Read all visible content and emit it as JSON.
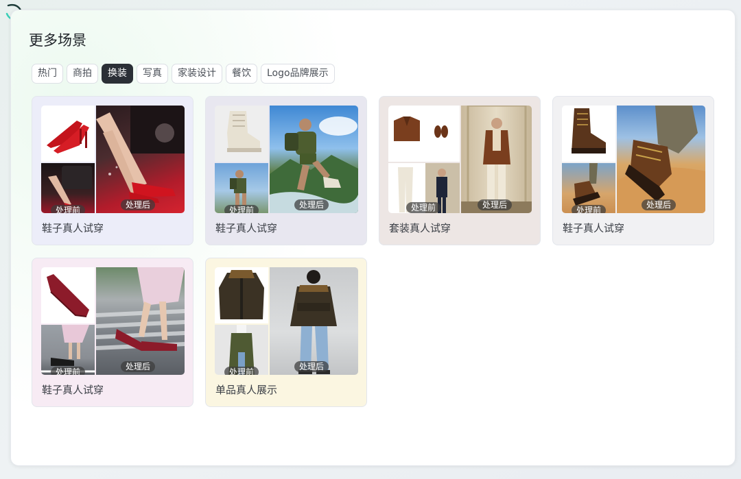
{
  "page": {
    "title": "更多场景"
  },
  "tabs": [
    {
      "label": "热门",
      "active": false
    },
    {
      "label": "商拍",
      "active": false
    },
    {
      "label": "换装",
      "active": true
    },
    {
      "label": "写真",
      "active": false
    },
    {
      "label": "家装设计",
      "active": false
    },
    {
      "label": "餐饮",
      "active": false
    },
    {
      "label": "Logo品牌展示",
      "active": false
    }
  ],
  "badges": {
    "before": "处理前",
    "after": "处理后"
  },
  "cards": [
    {
      "label": "鞋子真人试穿",
      "bg": "#ecedf9",
      "scene": "red-heels"
    },
    {
      "label": "鞋子真人试穿",
      "bg": "#e8e7f0",
      "scene": "hiking-boots"
    },
    {
      "label": "套装真人试穿",
      "bg": "#ede6e4",
      "scene": "suit"
    },
    {
      "label": "鞋子真人试穿",
      "bg": "#f1f1f3",
      "scene": "desert-boots"
    },
    {
      "label": "鞋子真人试穿",
      "bg": "#f7ebf4",
      "scene": "burgundy-flats"
    },
    {
      "label": "单品真人展示",
      "bg": "#fbf6e1",
      "scene": "leather-jacket"
    }
  ]
}
